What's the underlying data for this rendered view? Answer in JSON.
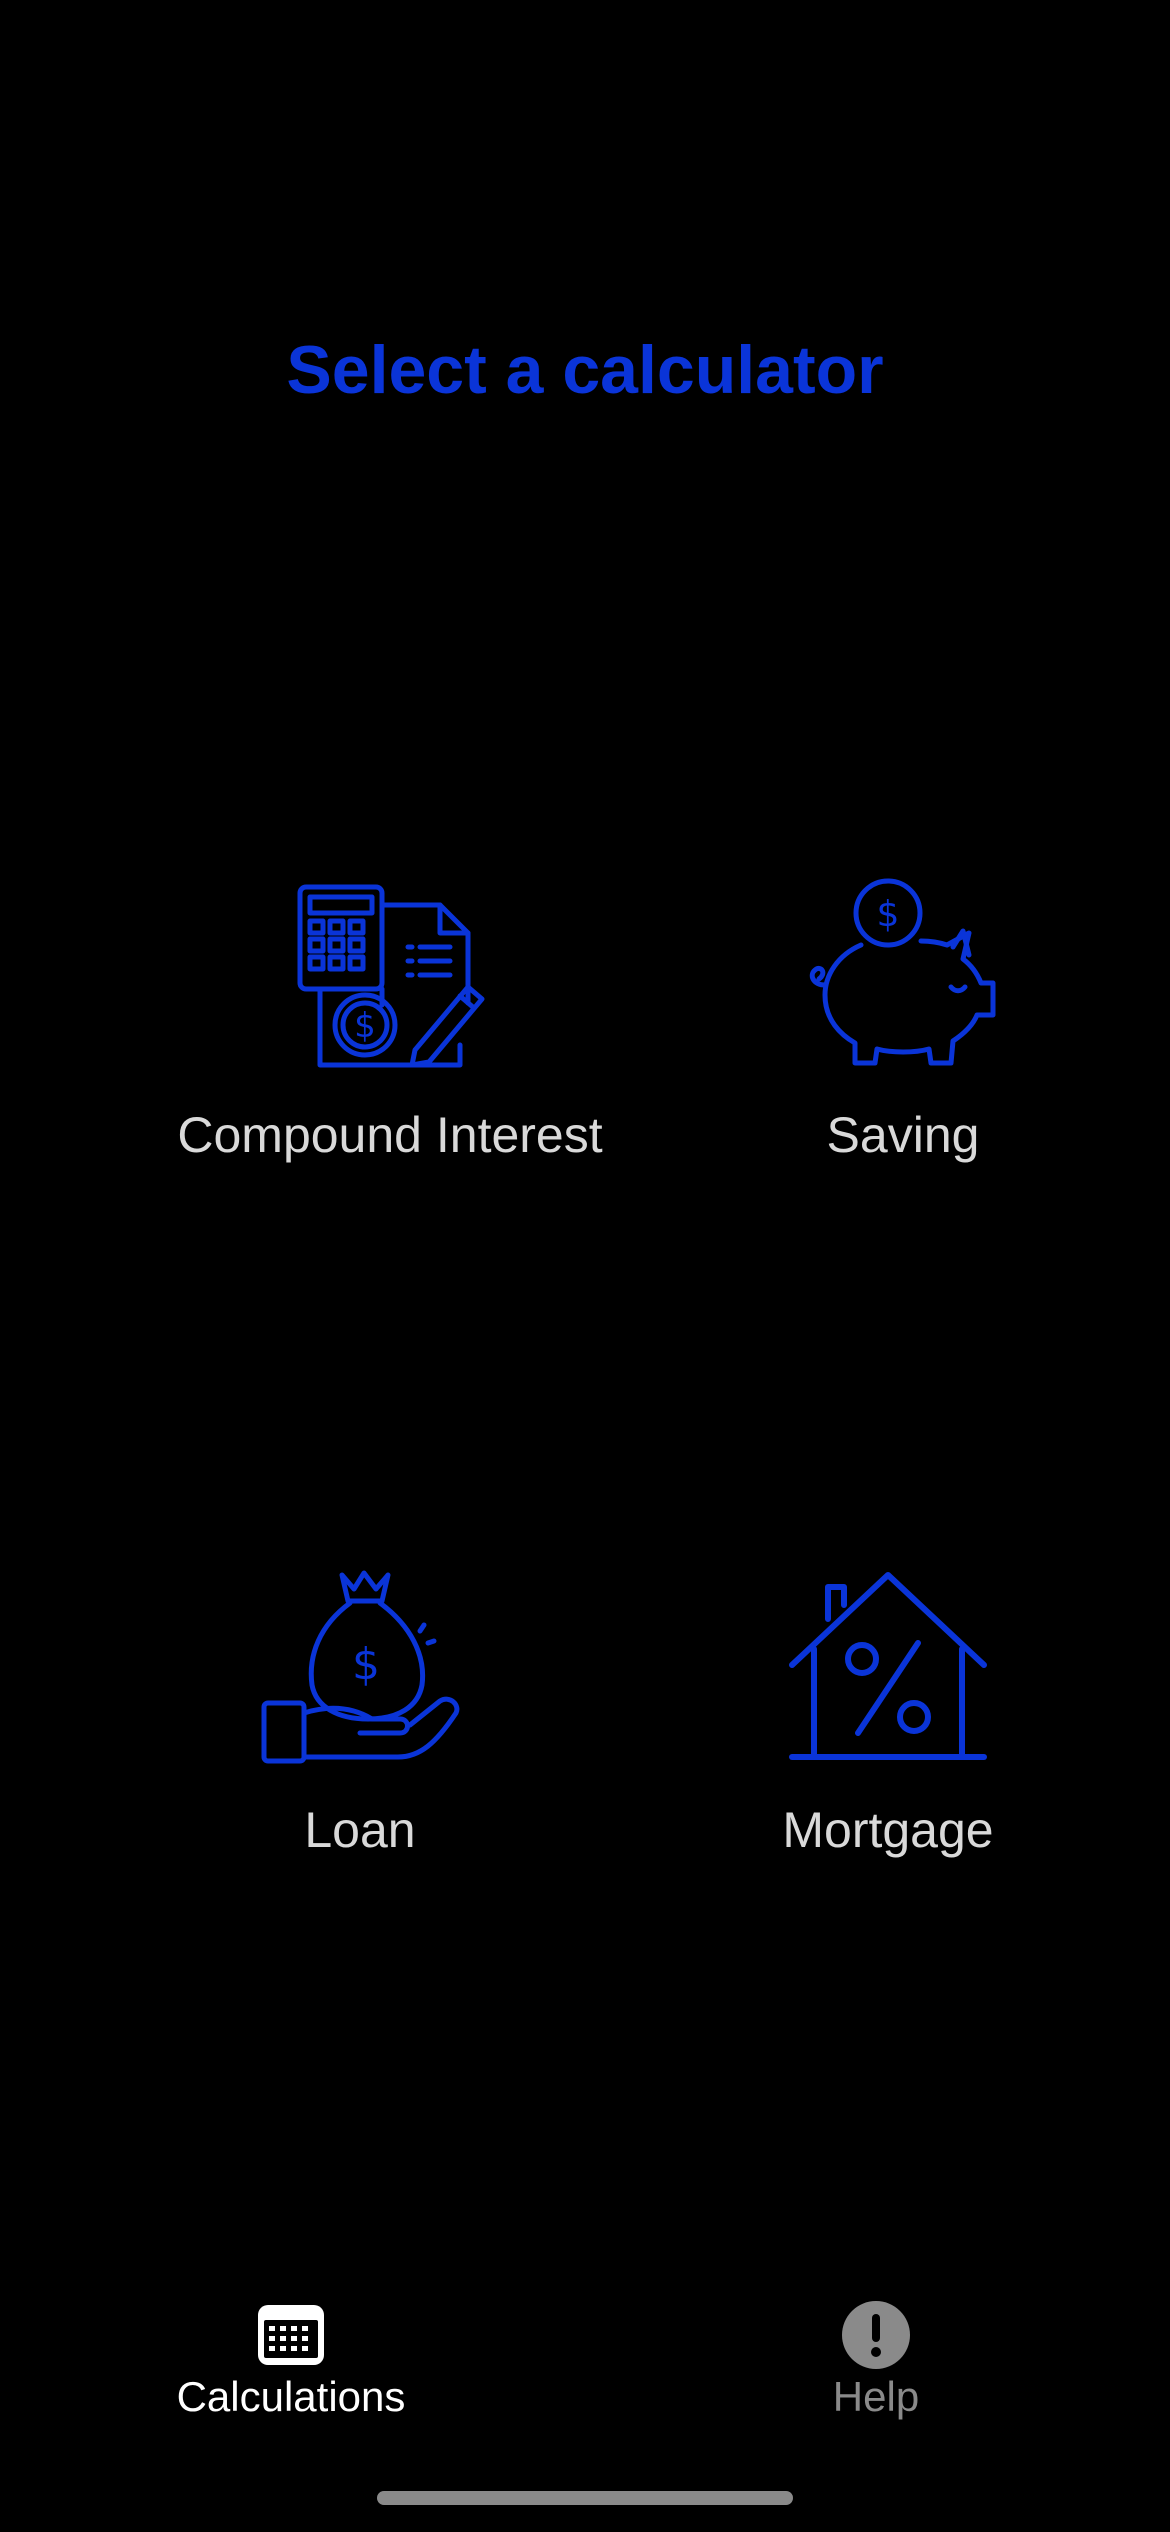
{
  "title": "Select a calculator",
  "calculators": [
    {
      "label": "Compound Interest",
      "icon": "calculator-document-icon"
    },
    {
      "label": "Saving",
      "icon": "piggy-bank-icon"
    },
    {
      "label": "Loan",
      "icon": "money-bag-hand-icon"
    },
    {
      "label": "Mortgage",
      "icon": "house-percent-icon"
    }
  ],
  "tabs": [
    {
      "label": "Calculations",
      "icon": "calculator-keypad-icon",
      "active": true
    },
    {
      "label": "Help",
      "icon": "exclamation-circle-icon",
      "active": false
    }
  ],
  "colors": {
    "accent": "#0a34d8",
    "background": "#000000",
    "label": "#d9d9d9",
    "tab_active": "#ffffff",
    "tab_inactive": "#8a8a8a"
  }
}
